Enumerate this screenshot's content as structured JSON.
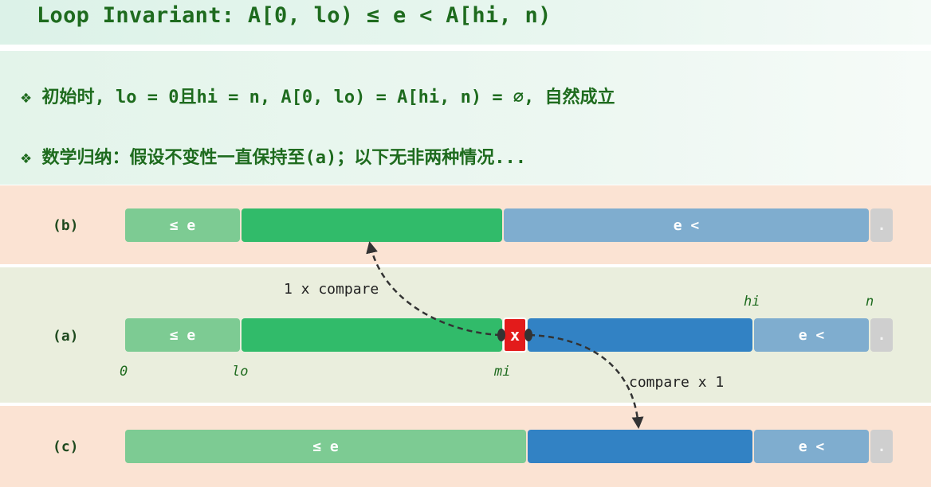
{
  "title": "Loop Invariant: A[0, lo) ≤ e < A[hi, n)",
  "bullets": [
    "❖ 初始时, lo = 0且hi = n, A[0, lo) = A[hi, n) = ∅, 自然成立",
    "❖ 数学归纳：假设不变性一直保持至(a)；以下无非两种情况..."
  ],
  "rows": {
    "b": {
      "label": "(b)",
      "le": "≤ e",
      "lt": "e <",
      "tail": "."
    },
    "a": {
      "label": "(a)",
      "le": "≤ e",
      "x": "x",
      "lt": "e <",
      "tail": "."
    },
    "c": {
      "label": "(c)",
      "le": "≤ e",
      "lt": "e <",
      "tail": "."
    }
  },
  "indices": {
    "zero": "0",
    "lo": "lo",
    "mi": "mi",
    "hi": "hi",
    "n": "n"
  },
  "annotations": {
    "up": "1 x compare",
    "down": "compare x 1"
  },
  "colors": {
    "le_region": "#7dcb93",
    "unknown_left": "#31bb6a",
    "unknown_right": "#3282c4",
    "gt_region": "#7fadcf",
    "pivot": "#e31b1b",
    "sentinel": "#cfcfcf"
  }
}
